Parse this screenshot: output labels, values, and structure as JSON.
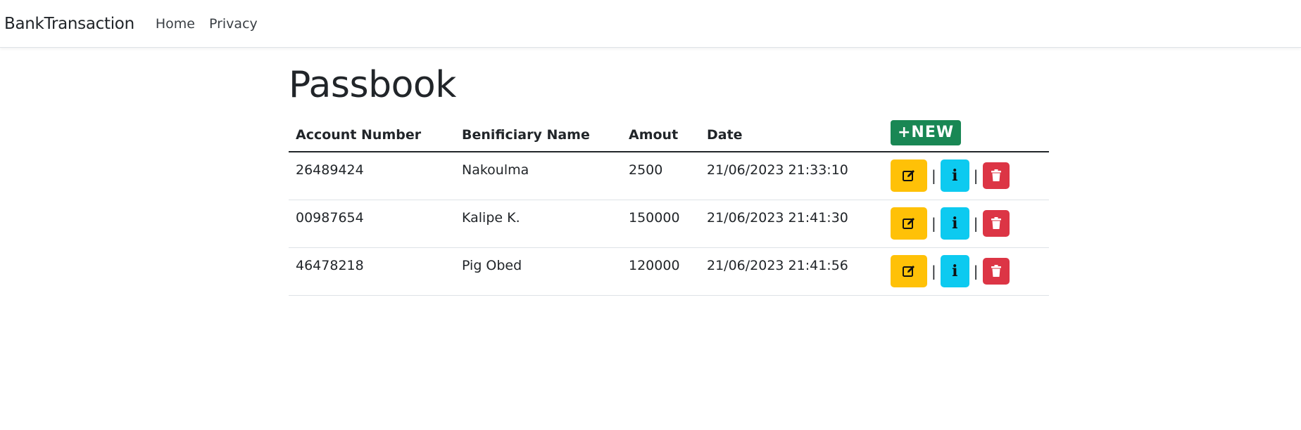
{
  "navbar": {
    "brand": "BankTransaction",
    "links": [
      "Home",
      "Privacy"
    ]
  },
  "main": {
    "title": "Passbook",
    "table": {
      "headers": [
        "Account Number",
        "Benificiary Name",
        "Amout",
        "Date"
      ],
      "new_button": "+NEW",
      "rows": [
        {
          "account": "26489424",
          "name": "Nakoulma",
          "amount": "2500",
          "date": "21/06/2023 21:33:10"
        },
        {
          "account": "00987654",
          "name": "Kalipe K.",
          "amount": "150000",
          "date": "21/06/2023 21:41:30"
        },
        {
          "account": "46478218",
          "name": "Pig Obed",
          "amount": "120000",
          "date": "21/06/2023 21:41:56"
        }
      ],
      "separator": "|",
      "icons": {
        "edit": "edit-icon",
        "info": "info-icon",
        "delete": "trash-icon"
      }
    }
  },
  "colors": {
    "edit": "#ffc107",
    "info": "#0dcaf0",
    "delete": "#dc3545",
    "new": "#198754"
  }
}
